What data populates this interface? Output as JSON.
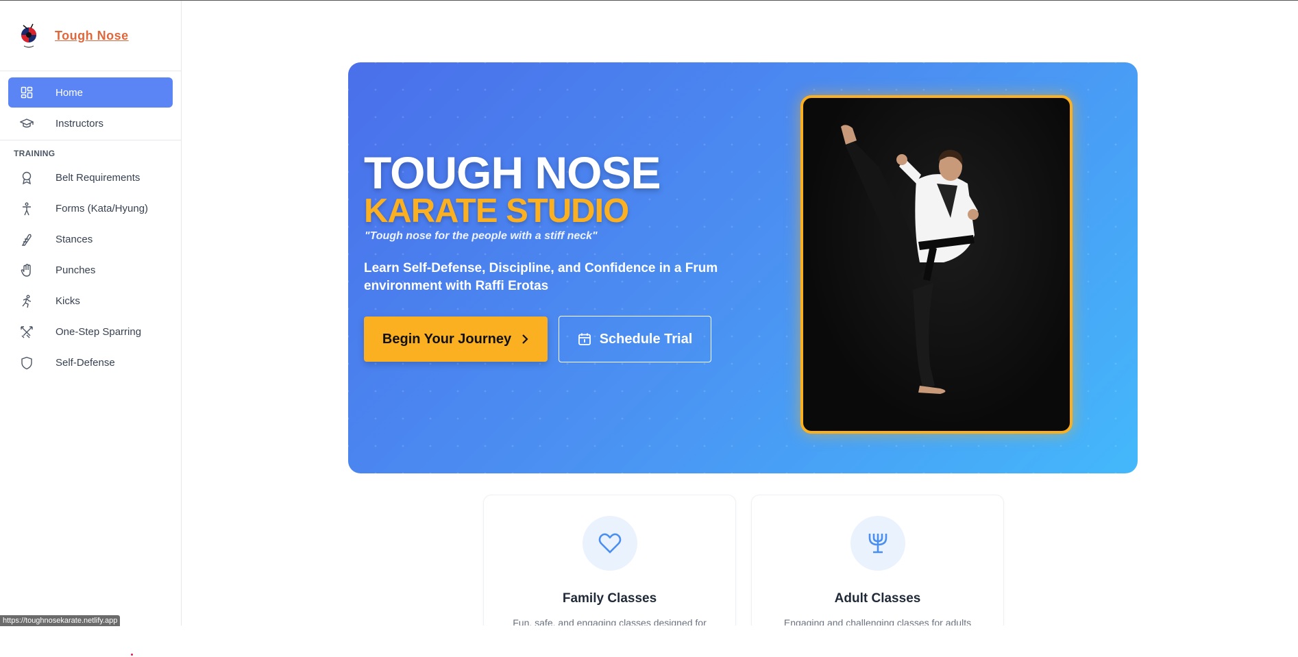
{
  "brand": {
    "name": "Tough Nose"
  },
  "sidebar": {
    "items": [
      {
        "label": "Home",
        "icon": "dashboard-icon",
        "active": true
      },
      {
        "label": "Instructors",
        "icon": "graduation-cap-icon"
      }
    ],
    "section_label": "TRAINING",
    "training_items": [
      {
        "label": "Belt Requirements",
        "icon": "award-icon"
      },
      {
        "label": "Forms (Kata/Hyung)",
        "icon": "person-standing-icon"
      },
      {
        "label": "Stances",
        "icon": "footprint-icon"
      },
      {
        "label": "Punches",
        "icon": "hand-icon"
      },
      {
        "label": "Kicks",
        "icon": "running-icon"
      },
      {
        "label": "One-Step Sparring",
        "icon": "swords-icon"
      },
      {
        "label": "Self-Defense",
        "icon": "shield-icon"
      }
    ]
  },
  "hero": {
    "title": "TOUGH NOSE",
    "subtitle": "KARATE STUDIO",
    "quote": "\"Tough nose for the people with a stiff neck\"",
    "description": "Learn Self-Defense, Discipline, and Confidence in a Frum environment with Raffi Erotas",
    "primary_button": "Begin Your Journey",
    "secondary_button": "Schedule Trial"
  },
  "cards": [
    {
      "title": "Family Classes",
      "text": "Fun, safe, and engaging classes designed for",
      "icon": "heart-icon"
    },
    {
      "title": "Adult Classes",
      "text": "Engaging and challenging classes for adults",
      "icon": "menorah-icon"
    }
  ],
  "status_bar": {
    "url": "https://toughnosekarate.netlify.app"
  },
  "colors": {
    "accent": "#5b85f5",
    "brand": "#e0673b",
    "gold": "#fbb021",
    "hero_start": "#4a6fea",
    "hero_end": "#44b8fb"
  }
}
